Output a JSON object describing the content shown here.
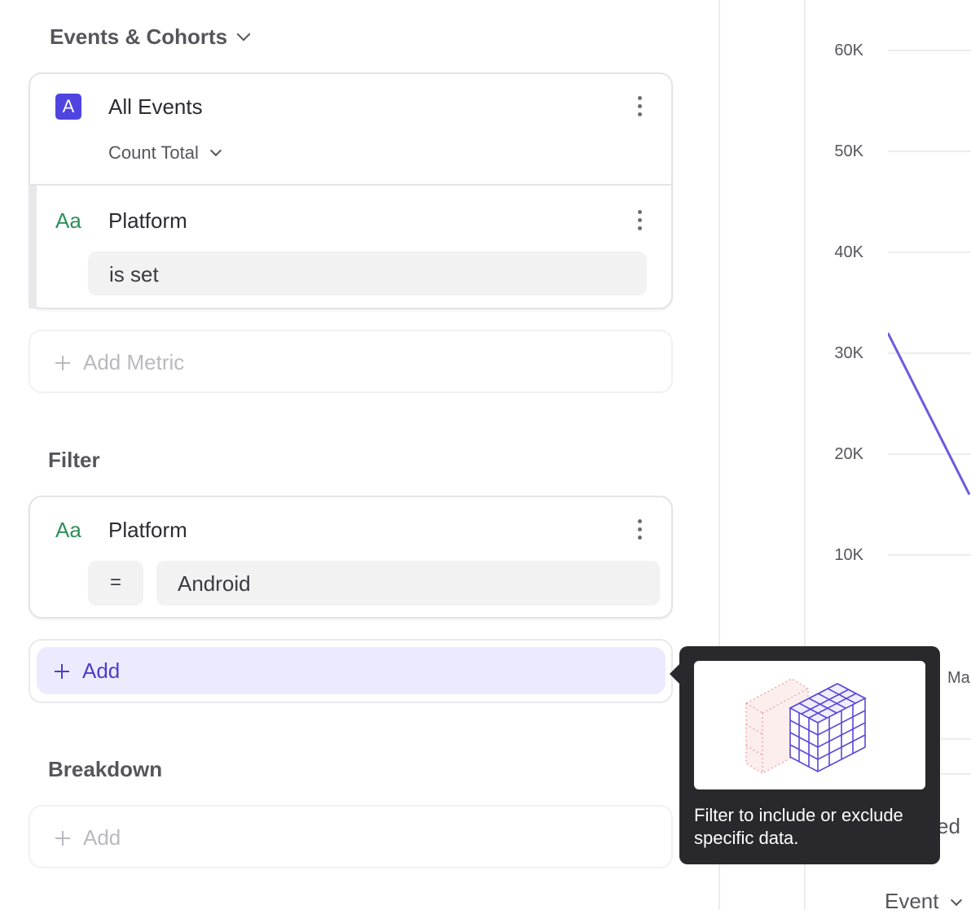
{
  "sections": {
    "events_title": "Events & Cohorts",
    "filter_title": "Filter",
    "breakdown_title": "Breakdown"
  },
  "metric": {
    "badge": "A",
    "name": "All Events",
    "aggregation": "Count Total",
    "property_type": "Aa",
    "property_name": "Platform",
    "condition": "is set"
  },
  "add_metric_label": "Add Metric",
  "filter": {
    "property_type": "Aa",
    "property_name": "Platform",
    "operator": "=",
    "value": "Android"
  },
  "filter_add_label": "Add",
  "breakdown_add_label": "Add",
  "tooltip": {
    "text": "Filter to include or exclude specific data."
  },
  "chart": {
    "x_label_partial": "Ma",
    "legend_partial": "ed",
    "footer_partial": "Event"
  },
  "chart_data": {
    "type": "line",
    "yticks": [
      "60K",
      "50K",
      "40K",
      "30K",
      "20K",
      "10K"
    ],
    "ylim": [
      0,
      60000
    ],
    "series": [
      {
        "color": "#6b5ae0",
        "values": [
          32000,
          16000
        ]
      }
    ]
  },
  "colors": {
    "accent": "#4f44e0",
    "string_type": "#2f8f5b",
    "add_active_bg": "#eceaff",
    "tooltip_bg": "#28282d",
    "line": "#6b5ae0"
  }
}
